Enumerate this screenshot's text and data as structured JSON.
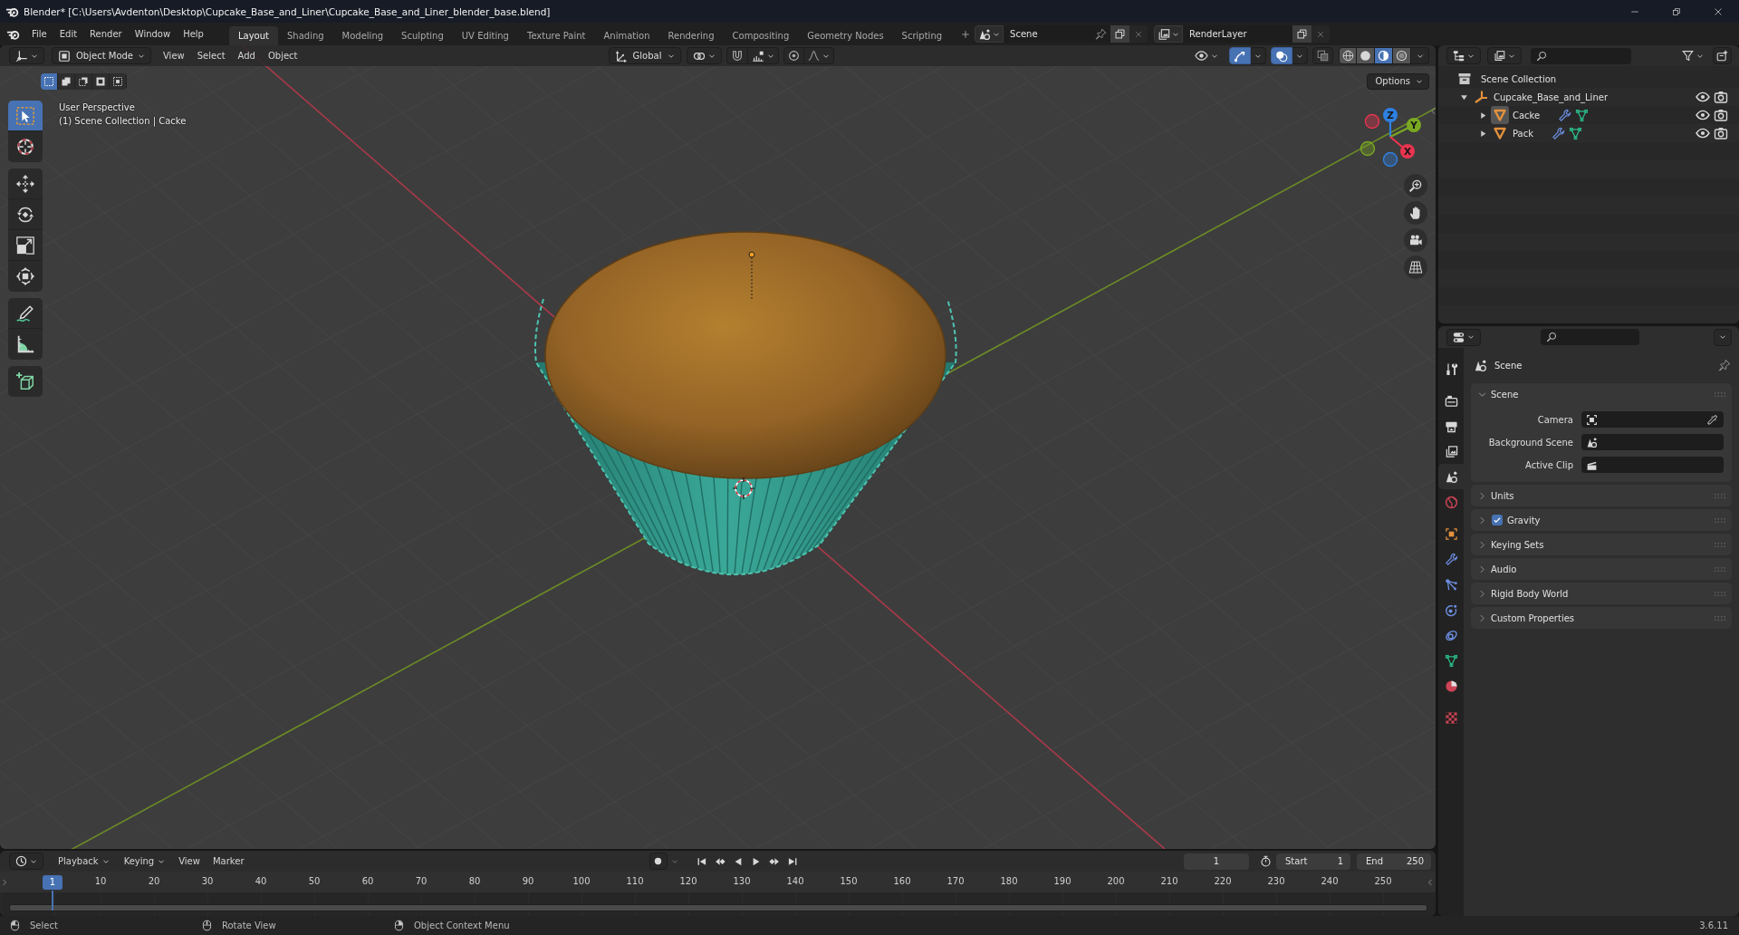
{
  "window": {
    "title": "Blender* [C:\\Users\\Avdenton\\Desktop\\Cupcake_Base_and_Liner\\Cupcake_Base_and_Liner_blender_base.blend]"
  },
  "menu": [
    "File",
    "Edit",
    "Render",
    "Window",
    "Help"
  ],
  "workspaces": [
    {
      "label": "Layout",
      "selected": true
    },
    {
      "label": "Shading",
      "selected": false
    },
    {
      "label": "Modeling",
      "selected": false
    },
    {
      "label": "Sculpting",
      "selected": false
    },
    {
      "label": "UV Editing",
      "selected": false
    },
    {
      "label": "Texture Paint",
      "selected": false
    },
    {
      "label": "Animation",
      "selected": false
    },
    {
      "label": "Rendering",
      "selected": false
    },
    {
      "label": "Compositing",
      "selected": false
    },
    {
      "label": "Geometry Nodes",
      "selected": false
    },
    {
      "label": "Scripting",
      "selected": false
    }
  ],
  "scene": {
    "value": "Scene"
  },
  "view_layer": {
    "value": "RenderLayer"
  },
  "viewport": {
    "mode": "Object Mode",
    "menus": [
      "View",
      "Select",
      "Add",
      "Object"
    ],
    "orientation": "Global",
    "snap": {
      "on": false
    },
    "proportional_editing": {
      "on": false
    },
    "gizmos": {
      "on": true
    },
    "overlays": {
      "on": true
    },
    "xray": {
      "on": false
    },
    "shading": [
      {
        "kind": "wireframe",
        "selected": false
      },
      {
        "kind": "solid",
        "selected": false
      },
      {
        "kind": "material",
        "selected": true
      },
      {
        "kind": "rendered",
        "selected": false
      }
    ],
    "selection_modes": [
      {
        "kind": "set",
        "selected": true
      },
      {
        "kind": "extend",
        "selected": false
      },
      {
        "kind": "subtract",
        "selected": false
      },
      {
        "kind": "invert",
        "selected": false
      },
      {
        "kind": "intersect",
        "selected": false
      }
    ],
    "options": "Options",
    "tools": [
      [
        {
          "kind": "select_box",
          "selected": true
        },
        {
          "kind": "cursor",
          "selected": false
        }
      ],
      [
        {
          "kind": "move",
          "selected": false
        },
        {
          "kind": "rotate",
          "selected": false
        },
        {
          "kind": "scale",
          "selected": false
        },
        {
          "kind": "transform",
          "selected": false
        }
      ],
      [
        {
          "kind": "annotate",
          "selected": false
        },
        {
          "kind": "measure",
          "selected": false
        }
      ],
      [
        {
          "kind": "add_cube",
          "selected": false
        }
      ]
    ],
    "info": [
      "User Perspective",
      "(1) Scene Collection | Cacke"
    ],
    "axes": [
      {
        "label": "Z",
        "color": "#2f80e2"
      },
      {
        "label": "Y",
        "color": "#7aa822"
      },
      {
        "label": "X",
        "color": "#e8344f"
      }
    ]
  },
  "outliner": {
    "root": "Scene Collection",
    "items": [
      {
        "label": "Cupcake_Base_and_Liner",
        "kind": "empty",
        "expanded": true,
        "visible": true,
        "renderable": true,
        "children": [
          {
            "label": "Cacke",
            "kind": "mesh",
            "expanded": false,
            "active": true,
            "visible": true,
            "renderable": true
          },
          {
            "label": "Pack",
            "kind": "mesh",
            "expanded": false,
            "active": false,
            "visible": true,
            "renderable": true
          }
        ]
      }
    ]
  },
  "properties": {
    "tabs": [
      [
        {
          "kind": "tool",
          "selected": false
        }
      ],
      [
        {
          "kind": "render",
          "selected": false
        },
        {
          "kind": "output",
          "selected": false
        },
        {
          "kind": "view_layer",
          "selected": false
        },
        {
          "kind": "scene",
          "selected": true
        },
        {
          "kind": "world",
          "selected": false
        }
      ],
      [
        {
          "kind": "object",
          "selected": false
        },
        {
          "kind": "modifiers",
          "selected": false
        },
        {
          "kind": "particles",
          "selected": false
        },
        {
          "kind": "physics",
          "selected": false
        },
        {
          "kind": "constraints",
          "selected": false
        },
        {
          "kind": "data",
          "selected": false
        },
        {
          "kind": "material",
          "selected": false
        }
      ],
      [
        {
          "kind": "texture",
          "selected": false
        }
      ]
    ],
    "title": "Scene",
    "panels": [
      {
        "label": "Scene",
        "kind": "plain",
        "expanded": true,
        "fields": [
          {
            "label": "Camera",
            "kind": "camera"
          },
          {
            "label": "Background Scene",
            "kind": "scene"
          },
          {
            "label": "Active Clip",
            "kind": "clip"
          }
        ]
      },
      {
        "label": "Units",
        "kind": "plain",
        "expanded": false
      },
      {
        "label": "Gravity",
        "kind": "toggle",
        "checked": true,
        "expanded": false
      },
      {
        "label": "Keying Sets",
        "kind": "plain",
        "expanded": false
      },
      {
        "label": "Audio",
        "kind": "plain",
        "expanded": false
      },
      {
        "label": "Rigid Body World",
        "kind": "plain",
        "expanded": false
      },
      {
        "label": "Custom Properties",
        "kind": "plain",
        "expanded": false
      }
    ]
  },
  "timeline": {
    "menus": [
      {
        "label": "Playback",
        "kind": "dropdown"
      },
      {
        "label": "Keying",
        "kind": "dropdown"
      },
      {
        "label": "View",
        "kind": "menu"
      },
      {
        "label": "Marker",
        "kind": "menu"
      }
    ],
    "auto_keying": {
      "on": false
    },
    "current_frame": "1",
    "start": {
      "label": "Start",
      "value": "1"
    },
    "end": {
      "label": "End",
      "value": "250"
    },
    "ruler": {
      "current": "1",
      "ticks": [
        "10",
        "20",
        "30",
        "40",
        "50",
        "60",
        "70",
        "80",
        "90",
        "100",
        "110",
        "120",
        "130",
        "140",
        "150",
        "160",
        "170",
        "180",
        "190",
        "200",
        "210",
        "220",
        "230",
        "240",
        "250"
      ]
    }
  },
  "status_bar": {
    "hints": [
      {
        "kind": "left",
        "label": "Select"
      },
      {
        "kind": "middle",
        "label": "Rotate View"
      },
      {
        "kind": "right",
        "label": "Object Context Menu"
      }
    ],
    "version": "3.6.11"
  }
}
